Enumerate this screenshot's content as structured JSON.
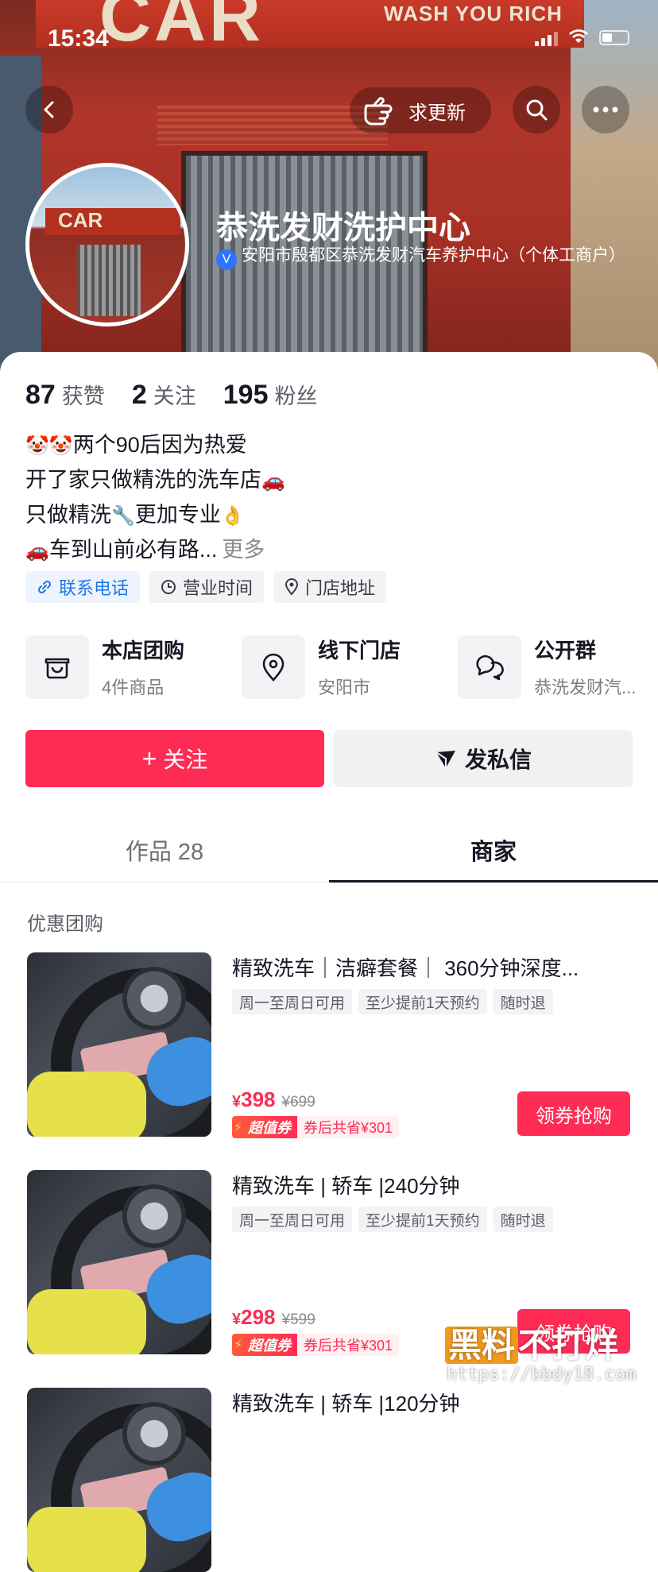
{
  "status_bar": {
    "time": "15:34"
  },
  "banner": {
    "sign_text": "CAR",
    "sign_subtext": "WASH YOU RICH",
    "update_label": "求更新"
  },
  "profile": {
    "name": "恭洗发财洗护中心",
    "verification": "安阳市殷都区恭洗发财汽车养护中心（个体工商户）",
    "avatar_sign": "CAR"
  },
  "stats": [
    {
      "value": "87",
      "label": "获赞"
    },
    {
      "value": "2",
      "label": "关注"
    },
    {
      "value": "195",
      "label": "粉丝"
    }
  ],
  "bio": {
    "line1": "两个90后因为热爱",
    "line2": "开了家只做精洗的洗车店",
    "line3_a": "只做精洗",
    "line3_b": "更加专业",
    "line4": "车到山前必有路...",
    "more": "更多"
  },
  "chips": {
    "phone": "联系电话",
    "hours": "营业时间",
    "address": "门店地址"
  },
  "services": [
    {
      "title": "本店团购",
      "subtitle": "4件商品",
      "icon": "shop-bag-icon"
    },
    {
      "title": "线下门店",
      "subtitle": "安阳市",
      "icon": "location-pin-icon"
    },
    {
      "title": "公开群",
      "subtitle": "恭洗发财汽...",
      "icon": "chat-bubbles-icon"
    }
  ],
  "actions": {
    "follow": "关注",
    "message": "发私信"
  },
  "tabs": {
    "works": "作品 28",
    "merchant": "商家"
  },
  "deals_section": {
    "title": "优惠团购",
    "deals": [
      {
        "title": "精致洗车｜洁癖套餐｜ 360分钟深度...",
        "tags": [
          "周一至周日可用",
          "至少提前1天预约",
          "随时退"
        ],
        "currency": "¥",
        "price": "398",
        "original_price": "¥699",
        "coupon_badge": "超值券",
        "coupon_save": "券后共省¥301",
        "button": "领券抢购"
      },
      {
        "title": "精致洗车 | 轿车 |240分钟",
        "tags": [
          "周一至周日可用",
          "至少提前1天预约",
          "随时退"
        ],
        "currency": "¥",
        "price": "298",
        "original_price": "¥599",
        "coupon_badge": "超值券",
        "coupon_save": "券后共省¥301",
        "button": "领券抢购"
      },
      {
        "title": "精致洗车 | 轿车 |120分钟"
      }
    ]
  },
  "watermark": {
    "part1": "黑料",
    "part2": "不打烊",
    "url": "https://bbdy18.com"
  },
  "colors": {
    "accent": "#fe2c55",
    "link_blue": "#1e77e8"
  }
}
